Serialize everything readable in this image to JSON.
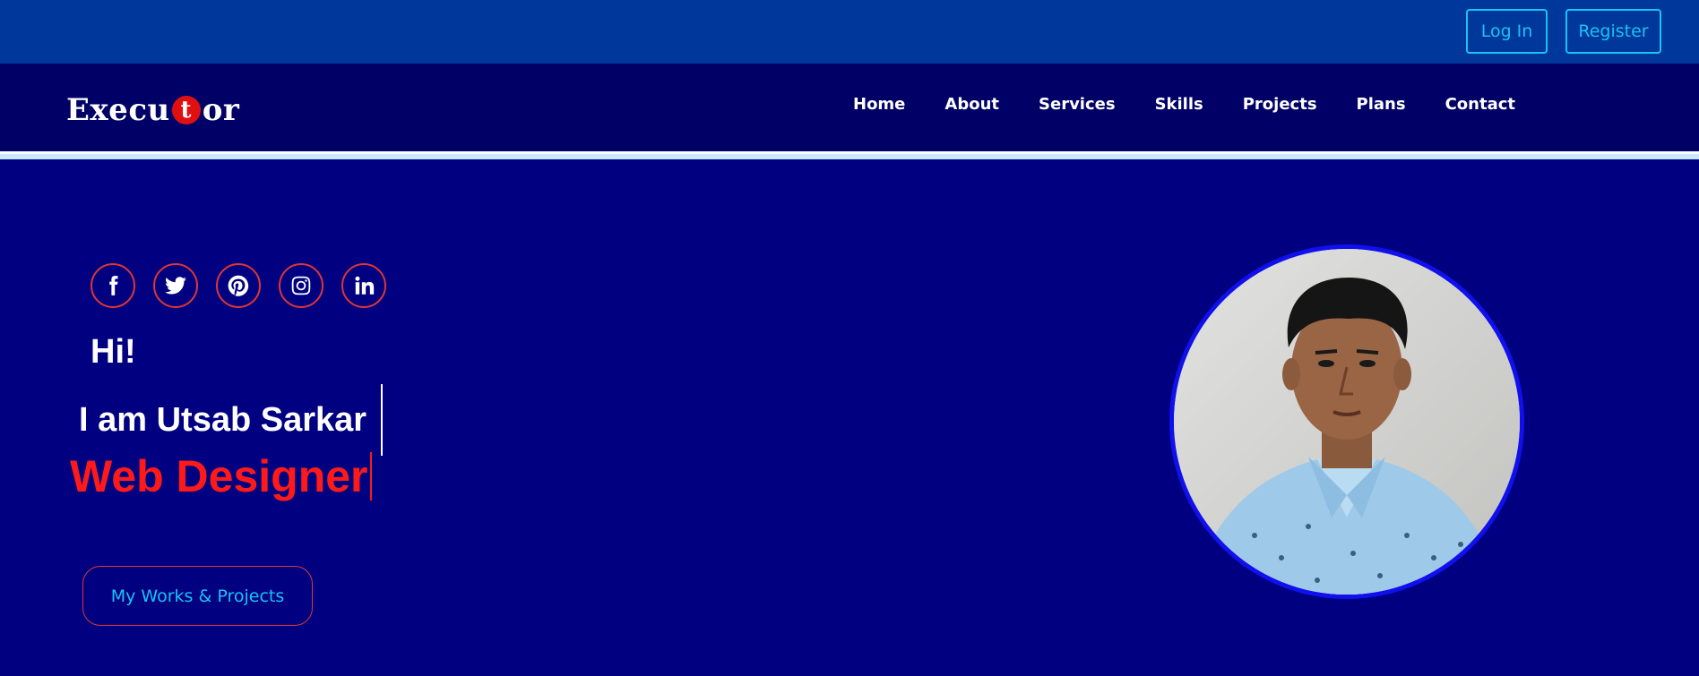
{
  "topbar": {
    "login_label": "Log In",
    "register_label": "Register",
    "accent": "#19c3f5"
  },
  "brand": {
    "logo_prefix": "Execu",
    "logo_circle_letter": "t",
    "logo_suffix": "or"
  },
  "nav": {
    "items": [
      {
        "label": "Home"
      },
      {
        "label": "About"
      },
      {
        "label": "Services"
      },
      {
        "label": "Skills"
      },
      {
        "label": "Projects"
      },
      {
        "label": "Plans"
      },
      {
        "label": "Contact"
      }
    ]
  },
  "hero": {
    "socials": [
      {
        "icon": "facebook-icon"
      },
      {
        "icon": "twitter-icon"
      },
      {
        "icon": "pinterest-icon"
      },
      {
        "icon": "instagram-icon"
      },
      {
        "icon": "linkedin-icon"
      }
    ],
    "greeting": "Hi!",
    "intro": "I am Utsab Sarkar",
    "role": "Web Designer",
    "cta_label": "My Works & Projects",
    "photo_icon": "profile-photo"
  },
  "colors": {
    "topbar_bg": "#00379b",
    "navbar_bg": "#000066",
    "hero_bg": "#000080",
    "highlight_red": "#ff1a1a",
    "social_border": "#e03535"
  }
}
